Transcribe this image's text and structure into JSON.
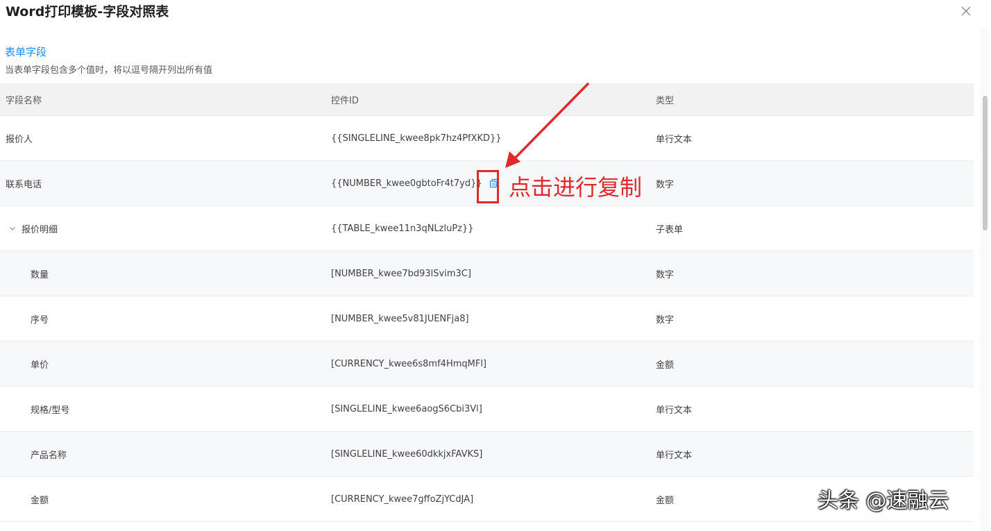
{
  "dialog": {
    "title": "Word打印模板-字段对照表"
  },
  "section": {
    "title": "表单字段",
    "description": "当表单字段包含多个值时，将以逗号隔开列出所有值"
  },
  "table": {
    "headers": [
      "字段名称",
      "控件ID",
      "类型"
    ],
    "rows": [
      {
        "name": "报价人",
        "id": "{{SINGLELINE_kwee8pk7hz4PfXKD}}",
        "type": "单行文本"
      },
      {
        "name": "联系电话",
        "id": "{{NUMBER_kwee0gbtoFr4t7yd}}",
        "type": "数字"
      },
      {
        "name": "报价明细",
        "id": "{{TABLE_kwee11n3qNLzluPz}}",
        "type": "子表单"
      },
      {
        "name": "数量",
        "id": "[NUMBER_kwee7bd93lSvim3C]",
        "type": "数字"
      },
      {
        "name": "序号",
        "id": "[NUMBER_kwee5v81JUENFja8]",
        "type": "数字"
      },
      {
        "name": "单价",
        "id": "[CURRENCY_kwee6s8mf4HmqMFl]",
        "type": "金额"
      },
      {
        "name": "规格/型号",
        "id": "[SINGLELINE_kwee6aogS6Cbi3Vl]",
        "type": "单行文本"
      },
      {
        "name": "产品名称",
        "id": "[SINGLELINE_kwee60dkkjxFAVKS]",
        "type": "单行文本"
      },
      {
        "name": "金额",
        "id": "[CURRENCY_kwee7gffoZjYCdJA]",
        "type": "金额"
      }
    ]
  },
  "annotation": {
    "text": "点击进行复制",
    "color": "#e02a2a"
  },
  "watermark": {
    "text": "头条 @速融云"
  },
  "colors": {
    "accent": "#1a8cf0",
    "header_bg": "#f2f2f2",
    "alt_row_bg": "#f7f8fa"
  },
  "icons": {
    "close": "close-icon",
    "copy": "copy-icon",
    "expand": "chevron-down-icon"
  }
}
